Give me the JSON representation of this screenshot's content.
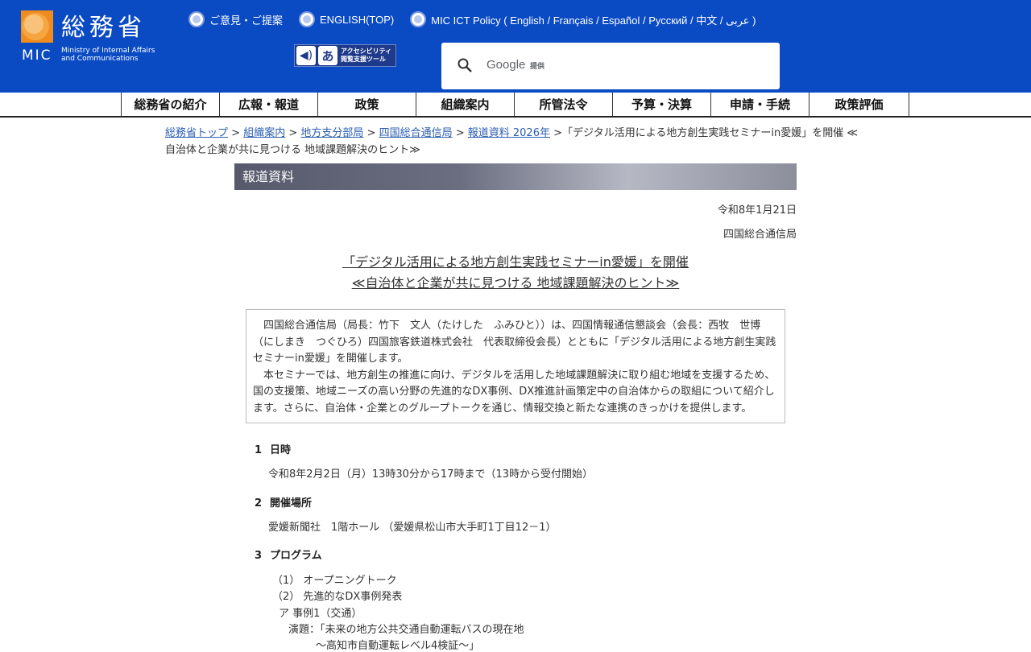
{
  "header": {
    "logo_kanji": "総務省",
    "logo_mic": "MIC",
    "logo_en_1": "Ministry of Internal Affairs",
    "logo_en_2": "and Communications",
    "links": [
      {
        "label": "ご意見・ご提案"
      },
      {
        "label": "ENGLISH(TOP)"
      },
      {
        "label": "MIC ICT Policy ( English / Français / Español / Русский / 中文 / عربی )"
      }
    ],
    "a11y_line1": "アクセシビリティ",
    "a11y_line2": "閲覧支援ツール",
    "search_brand": "Google",
    "search_sub": "提供"
  },
  "nav": [
    "総務省の紹介",
    "広報・報道",
    "政策",
    "組織案内",
    "所管法令",
    "予算・決算",
    "申請・手続",
    "政策評価"
  ],
  "breadcrumb": {
    "links": [
      "総務省トップ",
      "組織案内",
      "地方支分部局",
      "四国総合通信局",
      "報道資料 2026年"
    ],
    "current": "「デジタル活用による地方創生実践セミナーin愛媛」を開催 ≪自治体と企業が共に見つける 地域課題解決のヒント≫"
  },
  "press_label": "報道資料",
  "date": "令和8年1月21日",
  "issuer": "四国総合通信局",
  "title_line1": "「デジタル活用による地方創生実践セミナーin愛媛」を開催",
  "title_line2": "≪自治体と企業が共に見つける 地域課題解決のヒント≫",
  "summary": {
    "p1": "四国総合通信局（局長：竹下　文人（たけした　ふみひと））は、四国情報通信懇談会（会長：西牧　世博（にしまき　つぐひろ）四国旅客鉄道株式会社　代表取締役会長）とともに「デジタル活用による地方創生実践セミナーin愛媛」を開催します。",
    "p2": "本セミナーでは、地方創生の推進に向け、デジタルを活用した地域課題解決に取り組む地域を支援するため、国の支援策、地域ニーズの高い分野の先進的なDX事例、DX推進計画策定中の自治体からの取組について紹介します。さらに、自治体・企業とのグループトークを通じ、情報交換と新たな連携のきっかけを提供します。"
  },
  "sections": [
    {
      "num": "1",
      "title": "日時",
      "body": "令和8年2月2日（月）13時30分から17時まで（13時から受付開始）"
    },
    {
      "num": "2",
      "title": "開催場所",
      "body": "愛媛新聞社　1階ホール （愛媛県松山市大手町1丁目12－1）"
    },
    {
      "num": "3",
      "title": "プログラム"
    }
  ],
  "program": {
    "item1": "（1） オープニングトーク",
    "item2": "（2） 先進的なDX事例発表",
    "sub_a": "ア 事例1（交通）",
    "talk_label": "演題：「未来の地方公共交通自動運転バスの現在地",
    "talk_sub": "～高知市自動運転レベル4検証～」"
  }
}
